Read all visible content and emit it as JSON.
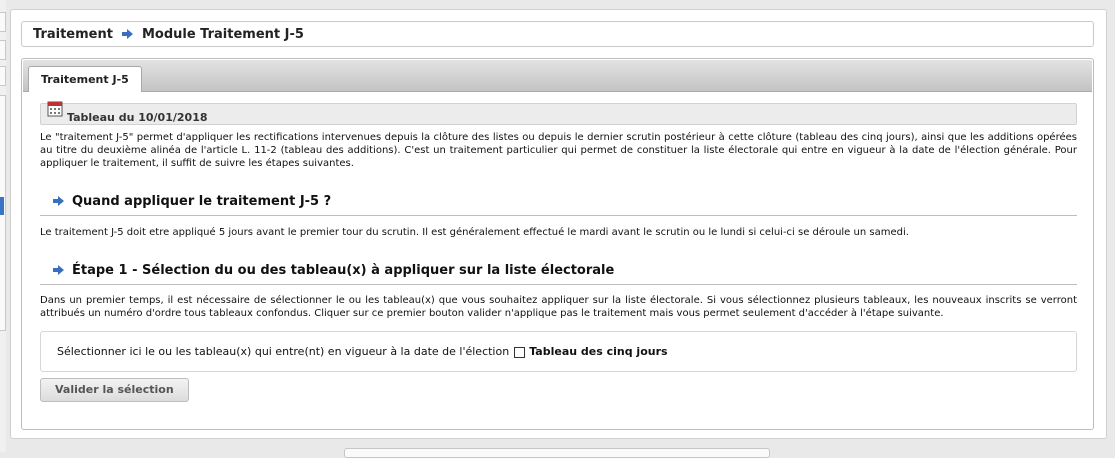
{
  "breadcrumb": {
    "root": "Traitement",
    "current": "Module Traitement J-5"
  },
  "tab": {
    "label": "Traitement J-5"
  },
  "header": {
    "title": "Tableau du 10/01/2018",
    "icon": "calendar-icon"
  },
  "intro": "Le \"traitement J-5\" permet d'appliquer les rectifications intervenues depuis la clôture des listes ou depuis le dernier scrutin postérieur à cette clôture (tableau des cinq jours), ainsi que les additions opérées au titre du deuxième alinéa de l'article L. 11-2 (tableau des additions). C'est un traitement particulier qui permet de constituer la liste électorale qui entre en vigueur à la date de l'élection générale. Pour appliquer le traitement, il suffit de suivre les étapes suivantes.",
  "section1": {
    "title": "Quand appliquer le traitement J-5 ?",
    "text": "Le traitement J-5 doit etre appliqué 5 jours avant le premier tour du scrutin. Il est généralement effectué le mardi avant le scrutin ou le lundi si celui-ci se déroule un samedi."
  },
  "section2": {
    "title": "Étape 1 - Sélection du ou des tableau(x) à appliquer sur la liste électorale",
    "text": "Dans un premier temps, il est nécessaire de sélectionner le ou les tableau(x) que vous souhaitez appliquer sur la liste électorale. Si vous sélectionnez plusieurs tableaux, les nouveaux inscrits se verront attribués un numéro d'ordre tous tableaux confondus. Cliquer sur ce premier bouton valider n'applique pas le traitement mais vous permet seulement d'accéder à l'étape suivante."
  },
  "selection": {
    "prompt": "Sélectionner ici le ou les tableau(x) qui entre(nt) en vigueur à la date de l'élection",
    "checkbox_label": "Tableau des cinq jours",
    "checked": false
  },
  "button": {
    "validate_label": "Valider la sélection"
  },
  "colors": {
    "arrow": "#3a6fc0",
    "tab_bar": "#c8c8c8"
  }
}
